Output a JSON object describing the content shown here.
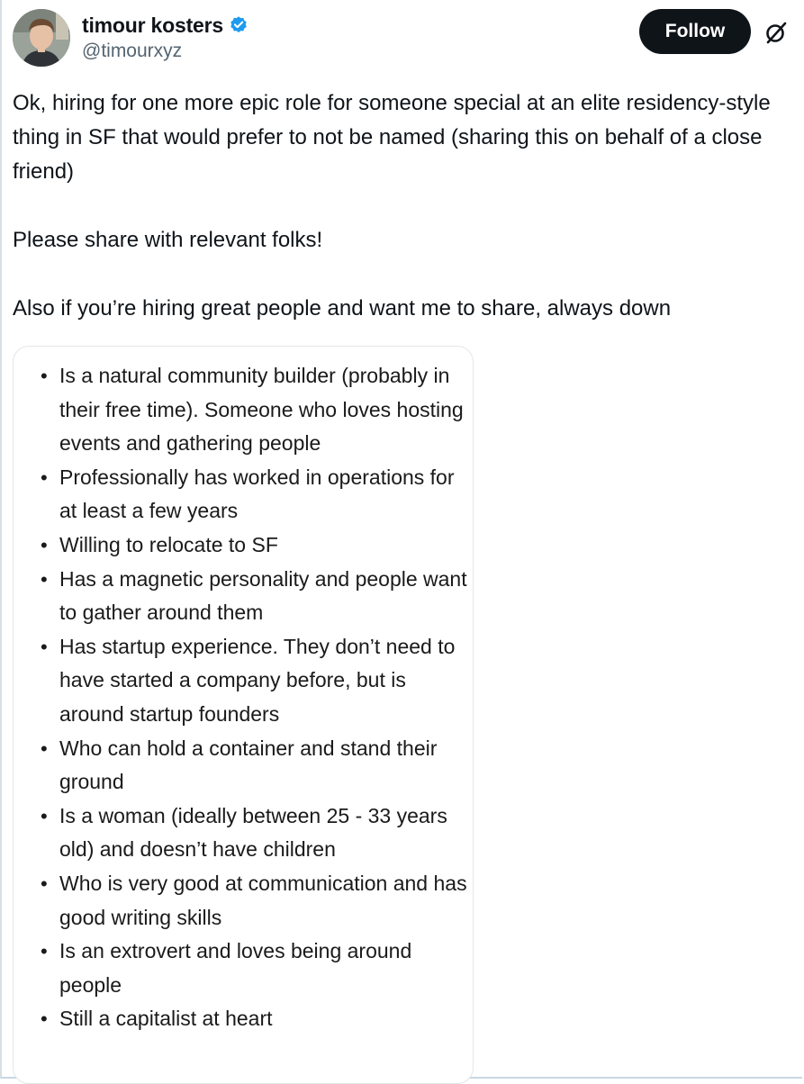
{
  "author": {
    "display_name": "timour kosters",
    "handle": "@timourxyz",
    "verified": true,
    "avatar_icon": "profile-photo"
  },
  "actions": {
    "follow_label": "Follow",
    "more_icon": "grok-slash-icon"
  },
  "tweet": {
    "paragraphs": [
      "Ok, hiring for one more epic role for someone special at an elite residency-style thing in SF that would prefer to not be named (sharing this on behalf of a close friend)",
      "Please share with relevant folks!",
      "Also if you’re hiring great people and want me to share, always down"
    ]
  },
  "attachment": {
    "bullets": [
      "Is a natural community builder (probably in their free time). Someone who loves hosting events and gathering people",
      "Professionally has worked in operations for at least a few years",
      "Willing to relocate to SF",
      "Has a magnetic personality and people want to gather around them",
      "Has startup experience. They don’t need to have started a company before, but is around startup founders",
      "Who can hold a container and stand their ground",
      "Is a woman (ideally between 25 - 33 years old) and doesn’t have children",
      "Who is very good at communication and has good writing skills",
      "Is an extrovert and loves being around people",
      "Still a capitalist at heart"
    ]
  },
  "colors": {
    "follow_bg": "#0f1419",
    "verified_blue": "#1d9bf0",
    "handle_gray": "#536471"
  }
}
